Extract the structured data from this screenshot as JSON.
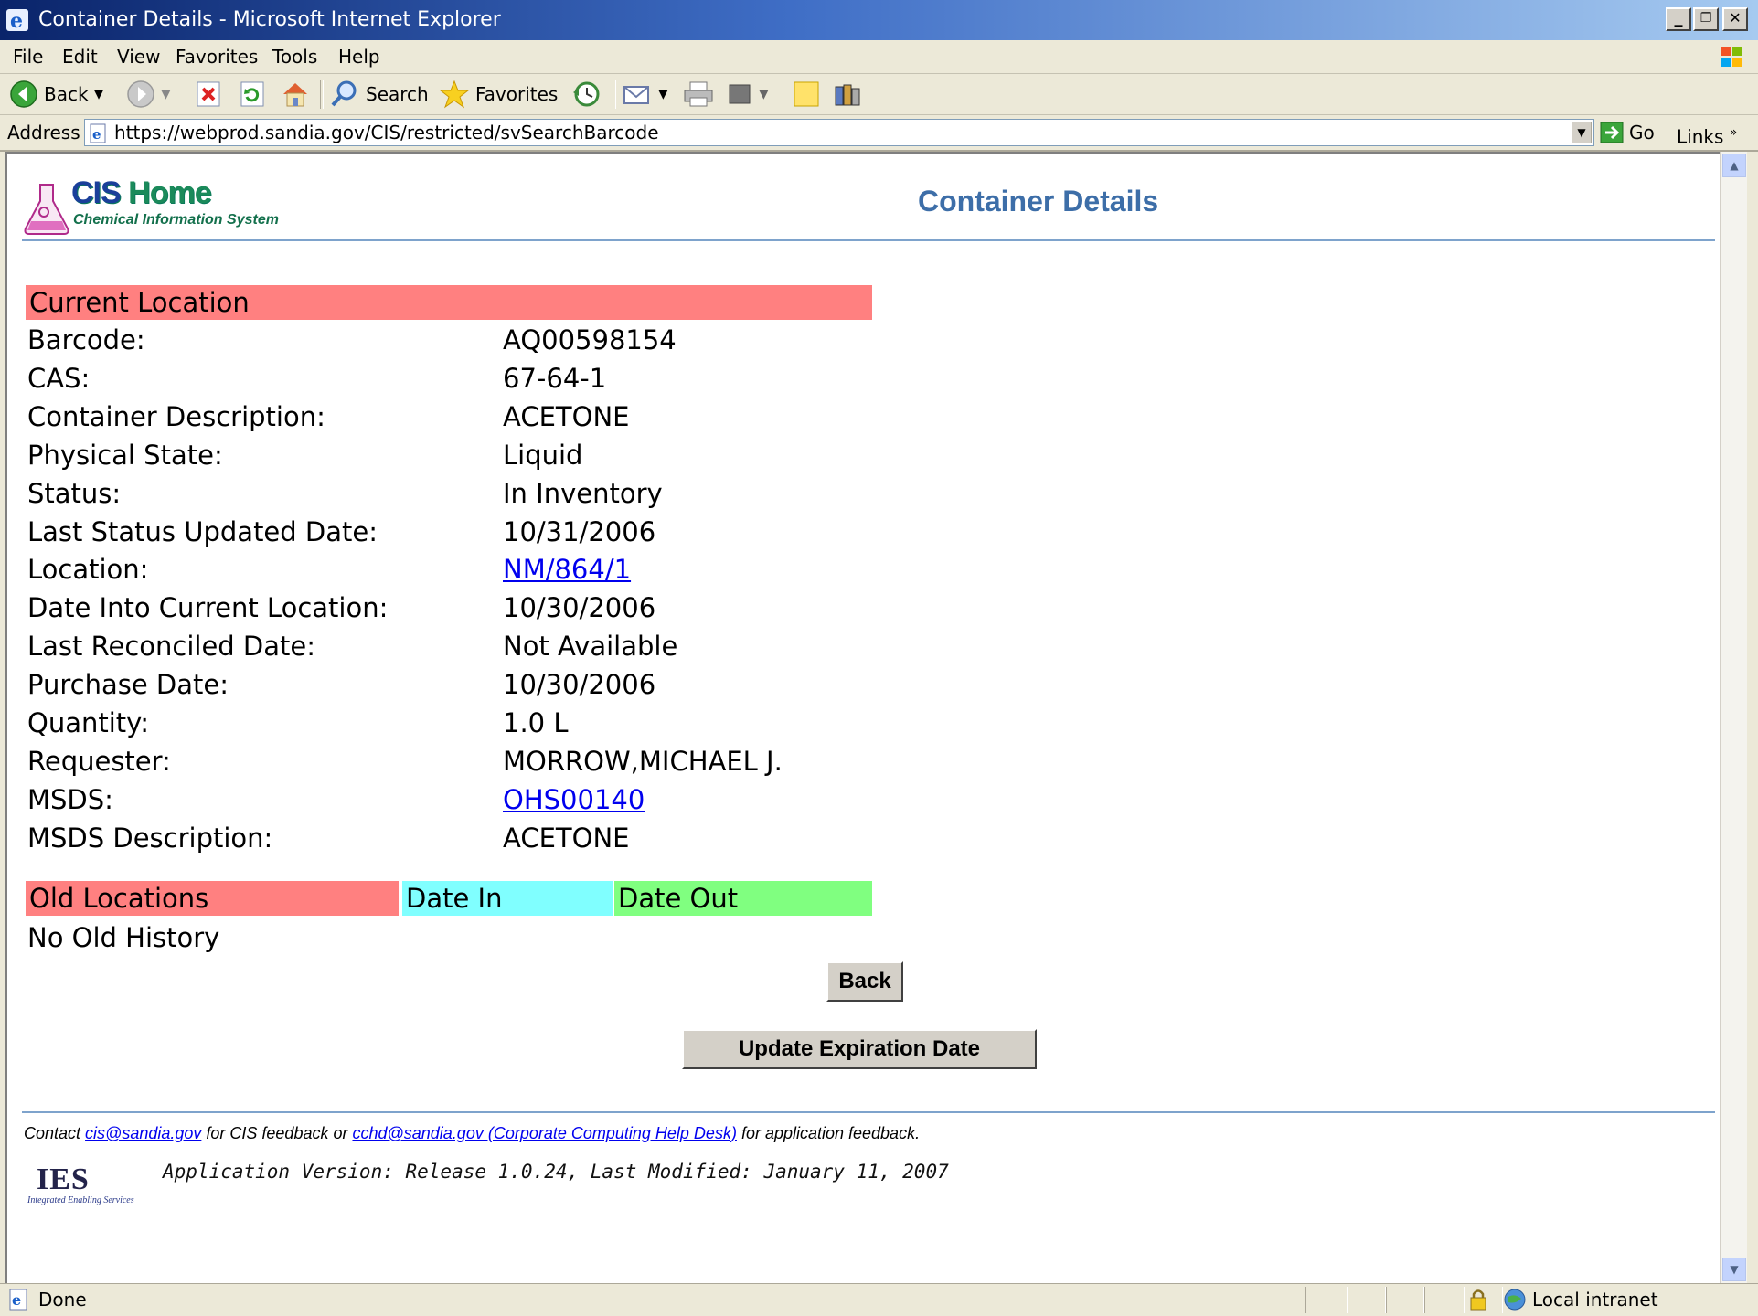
{
  "window": {
    "title": "Container Details - Microsoft Internet Explorer",
    "min_label": "_",
    "restore_label": "❐",
    "close_label": "✕"
  },
  "menu": {
    "items": [
      "File",
      "Edit",
      "View",
      "Favorites",
      "Tools",
      "Help"
    ]
  },
  "toolbar": {
    "back_label": "Back",
    "search_label": "Search",
    "favorites_label": "Favorites"
  },
  "address": {
    "label": "Address",
    "url": "https://webprod.sandia.gov/CIS/restricted/svSearchBarcode",
    "go_label": "Go",
    "links_label": "Links"
  },
  "header": {
    "logo_title_cis": "CIS",
    "logo_title_home": "Home",
    "logo_subtitle": "Chemical Information System",
    "page_title": "Container Details"
  },
  "current_location": {
    "heading": "Current Location",
    "rows": [
      {
        "label": "Barcode:",
        "value": "AQ00598154",
        "link": false
      },
      {
        "label": "CAS:",
        "value": "67-64-1",
        "link": false
      },
      {
        "label": "Container Description:",
        "value": "ACETONE",
        "link": false
      },
      {
        "label": "Physical State:",
        "value": "Liquid",
        "link": false
      },
      {
        "label": "Status:",
        "value": "In Inventory",
        "link": false
      },
      {
        "label": "Last Status Updated Date:",
        "value": "10/31/2006",
        "link": false
      },
      {
        "label": "Location:",
        "value": "NM/864/1",
        "link": true
      },
      {
        "label": "Date Into Current Location:",
        "value": "10/30/2006",
        "link": false
      },
      {
        "label": "Last Reconciled Date:",
        "value": "Not Available",
        "link": false
      },
      {
        "label": "Purchase Date:",
        "value": "10/30/2006",
        "link": false
      },
      {
        "label": "Quantity:",
        "value": "1.0 L",
        "link": false
      },
      {
        "label": "Requester:",
        "value": "MORROW,MICHAEL J.",
        "link": false
      },
      {
        "label": "MSDS:",
        "value": "OHS00140",
        "link": true
      },
      {
        "label": "MSDS Description:",
        "value": "ACETONE",
        "link": false
      }
    ]
  },
  "old_locations": {
    "col_location": "Old Locations",
    "col_date_in": "Date In",
    "col_date_out": "Date Out",
    "empty_text": "No Old History",
    "colors": {
      "location": "#ff8080",
      "date_in": "#80ffff",
      "date_out": "#80ff80"
    }
  },
  "buttons": {
    "back": "Back",
    "update_expiration": "Update Expiration Date"
  },
  "footer": {
    "contact_prefix": "Contact ",
    "cis_email": "cis@sandia.gov",
    "contact_mid": " for CIS feedback or ",
    "cchd_link": "cchd@sandia.gov (Corporate Computing Help Desk)",
    "contact_suffix": " for application feedback.",
    "ies_logo_text": "IES",
    "ies_logo_sub": "Integrated Enabling Services",
    "app_version": "Application Version: Release 1.0.24, Last Modified: January 11, 2007"
  },
  "status": {
    "text": "Done",
    "zone": "Local intranet"
  },
  "colors": {
    "current_location_header": "#ff8080",
    "page_title": "#3d6ea8",
    "rule": "#7ea3cc",
    "link": "#0000ee"
  }
}
